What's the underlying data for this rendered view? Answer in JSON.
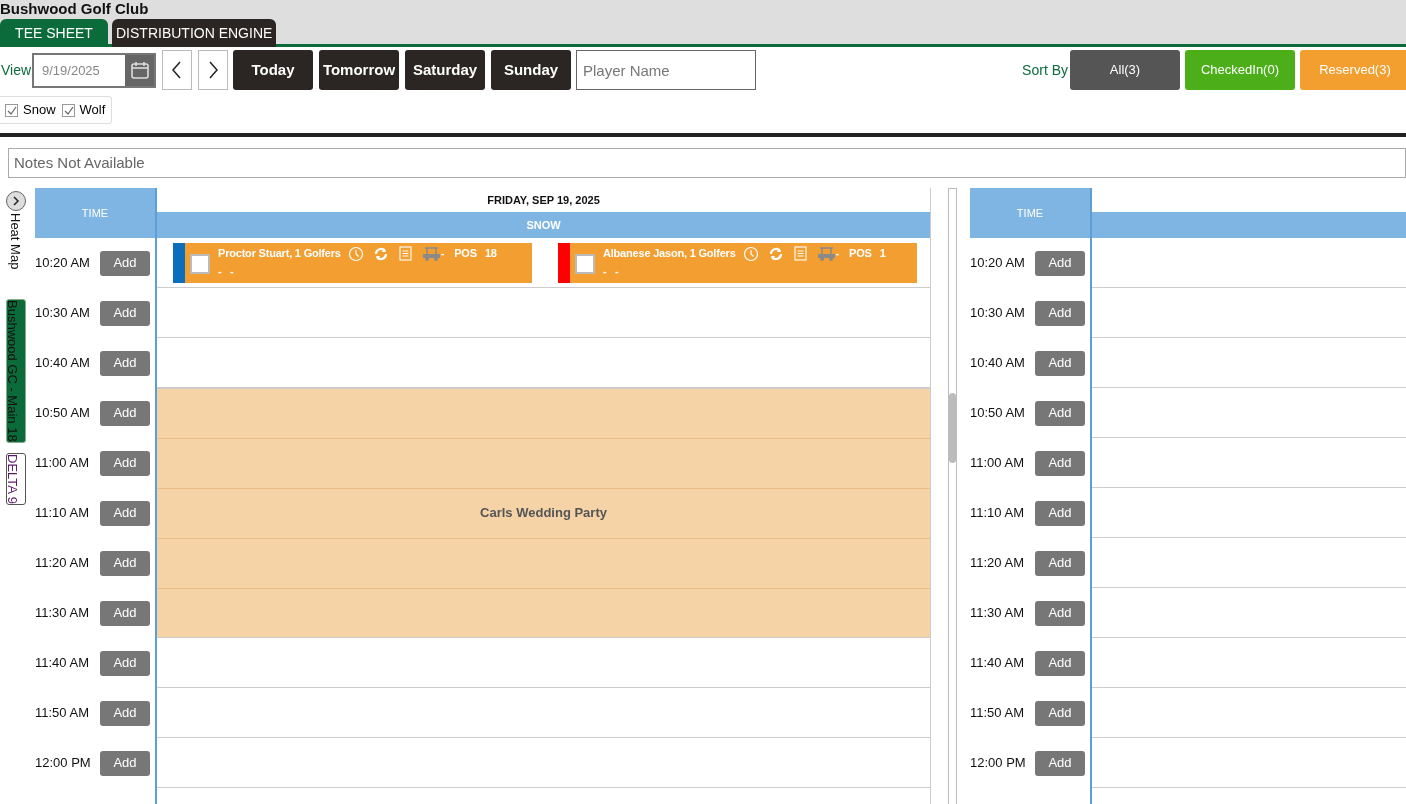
{
  "app": {
    "title": "Bushwood Golf Club"
  },
  "tabs": [
    {
      "label": "TEE SHEET",
      "selected": true
    },
    {
      "label": "DISTRIBUTION ENGINE",
      "selected": false
    }
  ],
  "toolbar": {
    "view_label": "View",
    "date": "9/19/2025",
    "quick_days": [
      "Today",
      "Tomorrow",
      "Saturday",
      "Sunday"
    ],
    "search": {
      "placeholder": "Player Name"
    },
    "sort_label": "Sort By",
    "sort_buttons": [
      {
        "label": "All(3)",
        "color": "#555555"
      },
      {
        "label": "CheckedIn(0)",
        "color": "#4caf1a"
      },
      {
        "label": "Reserved(3)",
        "color": "#f29f30"
      }
    ]
  },
  "filters": [
    {
      "label": "Snow",
      "checked": true
    },
    {
      "label": "Wolf",
      "checked": true
    }
  ],
  "notes": "Notes Not Available",
  "side": {
    "heat_map": "Heat Map",
    "courses": [
      {
        "label": "Bushwood GC - Main 18",
        "selected": true
      },
      {
        "label": "DELTA 9",
        "selected": false
      }
    ]
  },
  "sheet": {
    "date": "FRIDAY, SEP 19, 2025",
    "time_header": "TIME",
    "column": "SNOW",
    "block_label": "Carls Wedding Party",
    "slots": [
      {
        "time": "10:20 AM",
        "add": "Add",
        "blocked": false,
        "bookings": [
          {
            "name": "Proctor Stuart, 1 Golfers",
            "color": "#0a6ebd",
            "checked": false,
            "cart": "-",
            "pos": "POS",
            "pos_value": "18",
            "line2": "-   -"
          },
          {
            "name": "Albanese Jason, 1 Golfers",
            "color": "#ff0000",
            "checked": false,
            "cart": "-",
            "pos": "POS",
            "pos_value": "1",
            "line2": "-   -"
          }
        ]
      },
      {
        "time": "10:30 AM",
        "add": "Add",
        "blocked": false
      },
      {
        "time": "10:40 AM",
        "add": "Add",
        "blocked": false
      },
      {
        "time": "10:50 AM",
        "add": "Add",
        "blocked": true
      },
      {
        "time": "11:00 AM",
        "add": "Add",
        "blocked": true
      },
      {
        "time": "11:10 AM",
        "add": "Add",
        "blocked": true
      },
      {
        "time": "11:20 AM",
        "add": "Add",
        "blocked": true
      },
      {
        "time": "11:30 AM",
        "add": "Add",
        "blocked": true
      },
      {
        "time": "11:40 AM",
        "add": "Add",
        "blocked": false
      },
      {
        "time": "11:50 AM",
        "add": "Add",
        "blocked": false
      },
      {
        "time": "12:00 PM",
        "add": "Add",
        "blocked": false
      }
    ]
  },
  "sheet2": {
    "time_header": "TIME",
    "slots": [
      {
        "time": "10:20 AM",
        "add": "Add"
      },
      {
        "time": "10:30 AM",
        "add": "Add"
      },
      {
        "time": "10:40 AM",
        "add": "Add"
      },
      {
        "time": "10:50 AM",
        "add": "Add"
      },
      {
        "time": "11:00 AM",
        "add": "Add"
      },
      {
        "time": "11:10 AM",
        "add": "Add"
      },
      {
        "time": "11:20 AM",
        "add": "Add"
      },
      {
        "time": "11:30 AM",
        "add": "Add"
      },
      {
        "time": "11:40 AM",
        "add": "Add"
      },
      {
        "time": "11:50 AM",
        "add": "Add"
      },
      {
        "time": "12:00 PM",
        "add": "Add"
      }
    ]
  }
}
